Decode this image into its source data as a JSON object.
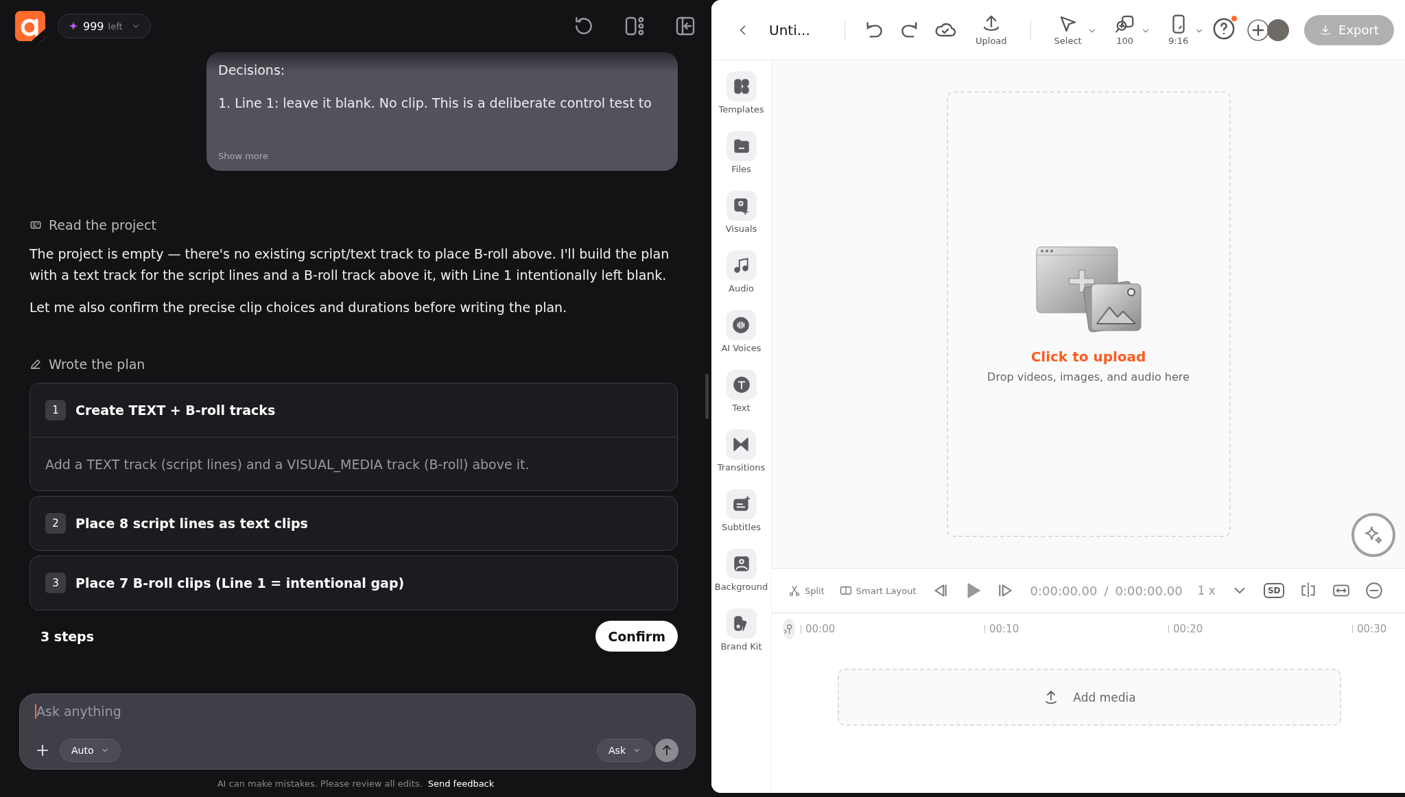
{
  "chat": {
    "credits": {
      "count": "999",
      "label": "left"
    },
    "message": {
      "lines": [
        "Decisions:",
        "1. Line 1: leave it blank. No clip. This is a deliberate control test to"
      ],
      "more": "Show more"
    },
    "activity": [
      {
        "kind": "read",
        "label": "Read the project"
      }
    ],
    "paragraphs": [
      "The project is empty — there's no existing script/text track to place B-roll above. I'll build the plan with a text track for the script lines and a B-roll track above it, with Line 1 intentionally left blank.",
      "Let me also confirm the precise clip choices and durations before writing the plan."
    ],
    "plan_heading": {
      "kind": "write",
      "label": "Wrote the plan"
    },
    "steps": [
      {
        "number": "1",
        "title": "Create TEXT + B-roll tracks",
        "detail": "Add a TEXT track (script lines) and a VISUAL_MEDIA track (B-roll) above it."
      },
      {
        "number": "2",
        "title": "Place 8 script lines as text clips"
      },
      {
        "number": "3",
        "title": "Place 7 B-roll clips (Line 1 = intentional gap)"
      }
    ],
    "step_count": "3 steps",
    "confirm": "Confirm",
    "input": {
      "placeholder": "Ask anything",
      "mode": "Auto",
      "ask": "Ask"
    },
    "footer": {
      "note": "AI can make mistakes. Please review all edits.",
      "link": "Send feedback"
    }
  },
  "editor": {
    "title": "Unti...",
    "tools": [
      {
        "kind": "upload",
        "label": "Upload"
      },
      {
        "kind": "select",
        "label": "Select"
      },
      {
        "kind": "zoom",
        "label": "100"
      },
      {
        "kind": "ratio",
        "label": "9:16"
      }
    ],
    "export": "Export",
    "sidebar": [
      {
        "kind": "templates",
        "label": "Templates"
      },
      {
        "kind": "files",
        "label": "Files"
      },
      {
        "kind": "visuals",
        "label": "Visuals"
      },
      {
        "kind": "audio",
        "label": "Audio"
      },
      {
        "kind": "voices",
        "label": "AI Voices"
      },
      {
        "kind": "text",
        "label": "Text"
      },
      {
        "kind": "transitions",
        "label": "Transitions"
      },
      {
        "kind": "subtitles",
        "label": "Subtitles"
      },
      {
        "kind": "background",
        "label": "Background"
      },
      {
        "kind": "brand",
        "label": "Brand Kit"
      }
    ],
    "upload": {
      "title": "Click to upload",
      "hint": "Drop videos, images, and audio here"
    },
    "timeline": {
      "split": "Split",
      "smart_layout": "Smart Layout",
      "current": "0:00:00.00",
      "separator": "/",
      "total": "0:00:00.00",
      "speed": "1 x",
      "quality": "SD",
      "ticks": [
        "00:00",
        "00:10",
        "00:20",
        "00:30"
      ],
      "add_media": "Add media"
    }
  }
}
